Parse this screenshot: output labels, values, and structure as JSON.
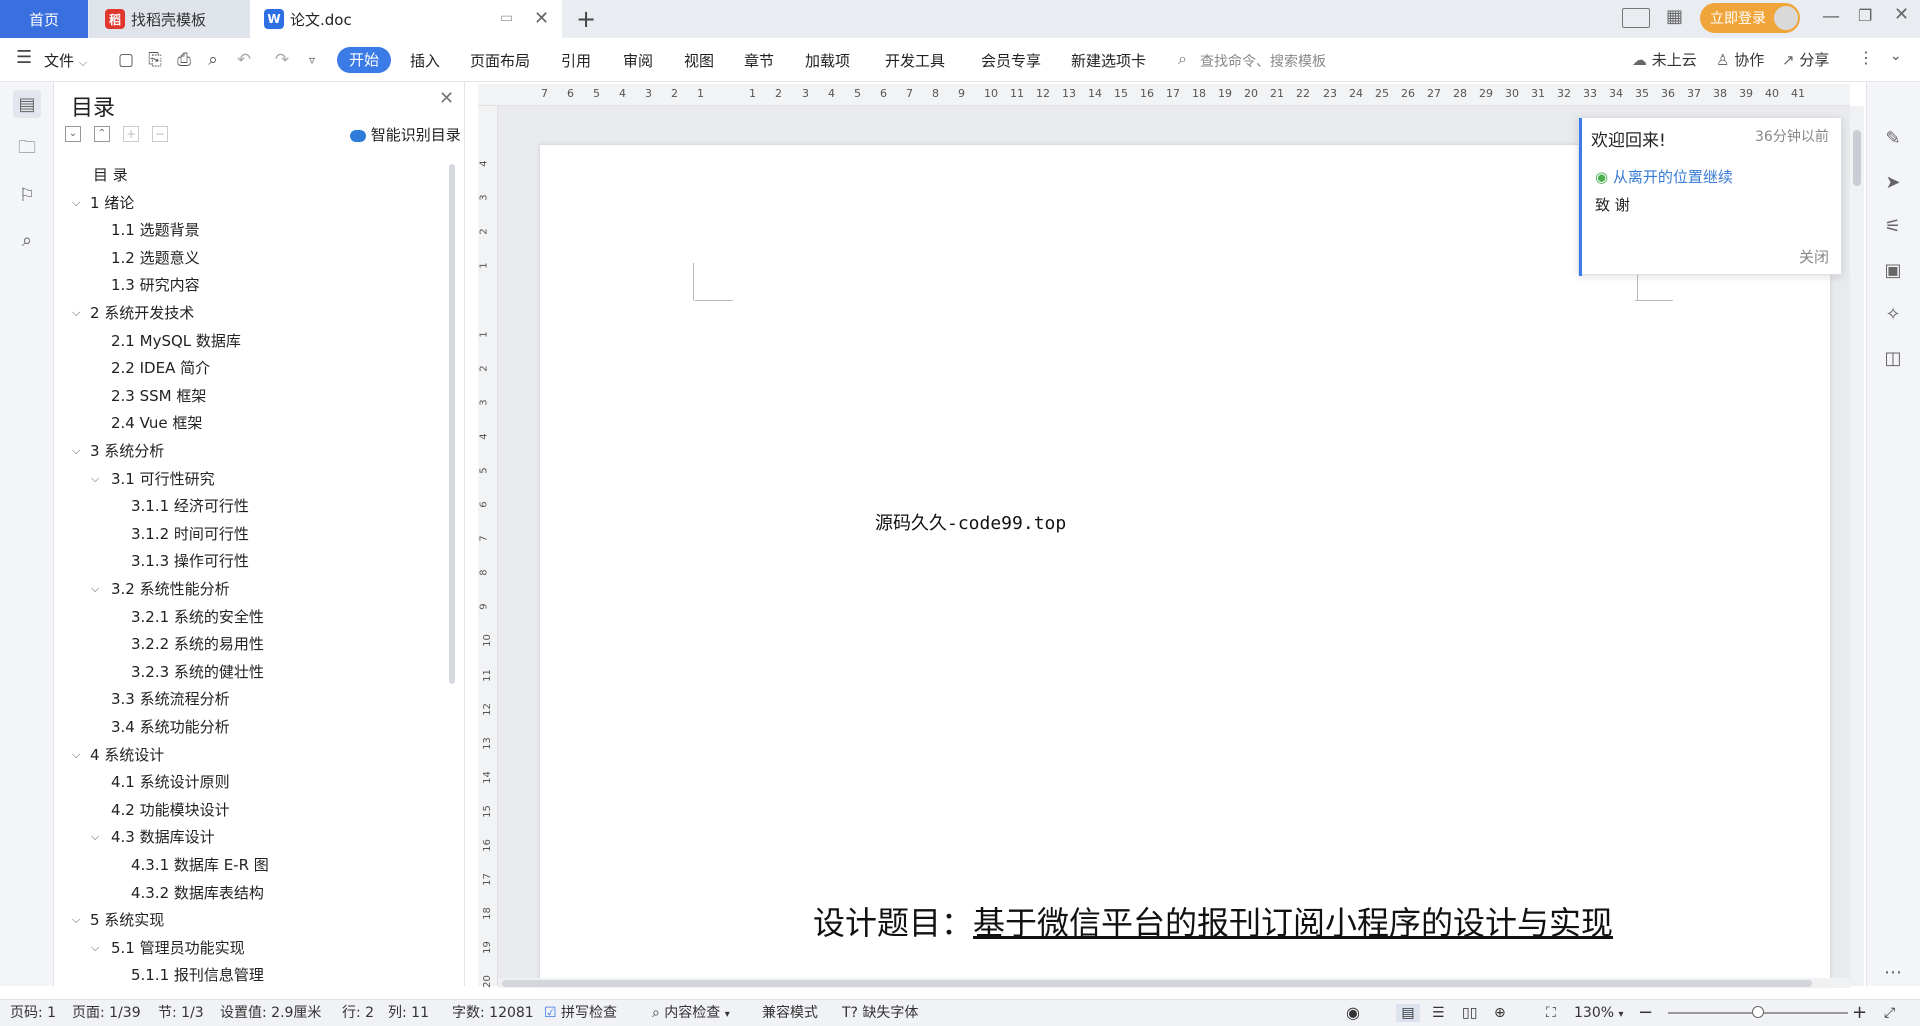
{
  "tabs": {
    "home": "首页",
    "daoke": "找稻壳模板",
    "doc": "论文.doc"
  },
  "header": {
    "login": "立即登录"
  },
  "toolbar": {
    "file": "文件",
    "menus": [
      "开始",
      "插入",
      "页面布局",
      "引用",
      "审阅",
      "视图",
      "章节",
      "加载项",
      "开发工具",
      "会员专享",
      "新建选项卡"
    ],
    "search_placeholder": "查找命令、搜索模板",
    "cloud": "未上云",
    "collab": "协作",
    "share": "分享"
  },
  "toc": {
    "title": "目录",
    "smart": "智能识别目录",
    "items": [
      {
        "text": "目  录",
        "level": 0,
        "chev": false
      },
      {
        "text": "1 绪论",
        "level": 0,
        "chev": true
      },
      {
        "text": "1.1  选题背景",
        "level": 1,
        "chev": false
      },
      {
        "text": "1.2  选题意义",
        "level": 1,
        "chev": false
      },
      {
        "text": "1.3  研究内容",
        "level": 1,
        "chev": false
      },
      {
        "text": "2  系统开发技术",
        "level": 0,
        "chev": true
      },
      {
        "text": "2.1 MySQL 数据库",
        "level": 1,
        "chev": false
      },
      {
        "text": "2.2 IDEA 简介",
        "level": 1,
        "chev": false
      },
      {
        "text": "2.3 SSM 框架",
        "level": 1,
        "chev": false
      },
      {
        "text": "2.4 Vue 框架",
        "level": 1,
        "chev": false
      },
      {
        "text": "3  系统分析",
        "level": 0,
        "chev": true
      },
      {
        "text": "3.1  可行性研究",
        "level": 1,
        "chev": true
      },
      {
        "text": "3.1.1  经济可行性",
        "level": 2,
        "chev": false
      },
      {
        "text": "3.1.2  时间可行性",
        "level": 2,
        "chev": false
      },
      {
        "text": "3.1.3  操作可行性",
        "level": 2,
        "chev": false
      },
      {
        "text": "3.2  系统性能分析",
        "level": 1,
        "chev": true
      },
      {
        "text": "3.2.1  系统的安全性",
        "level": 2,
        "chev": false
      },
      {
        "text": "3.2.2  系统的易用性",
        "level": 2,
        "chev": false
      },
      {
        "text": "3.2.3  系统的健壮性",
        "level": 2,
        "chev": false
      },
      {
        "text": "3.3  系统流程分析",
        "level": 1,
        "chev": false
      },
      {
        "text": "3.4  系统功能分析",
        "level": 1,
        "chev": false
      },
      {
        "text": "4  系统设计",
        "level": 0,
        "chev": true
      },
      {
        "text": "4.1  系统设计原则",
        "level": 1,
        "chev": false
      },
      {
        "text": "4.2  功能模块设计",
        "level": 1,
        "chev": false
      },
      {
        "text": "4.3  数据库设计",
        "level": 1,
        "chev": true
      },
      {
        "text": "4.3.1  数据库 E-R 图",
        "level": 2,
        "chev": false
      },
      {
        "text": "4.3.2  数据库表结构",
        "level": 2,
        "chev": false
      },
      {
        "text": "5  系统实现",
        "level": 0,
        "chev": true
      },
      {
        "text": "5.1  管理员功能实现",
        "level": 1,
        "chev": true
      },
      {
        "text": "5.1.1  报刊信息管理",
        "level": 2,
        "chev": false
      }
    ]
  },
  "ruler": {
    "top": [
      "7",
      "6",
      "5",
      "4",
      "3",
      "2",
      "1",
      "",
      "1",
      "2",
      "3",
      "4",
      "5",
      "6",
      "7",
      "8",
      "9",
      "10",
      "11",
      "12",
      "13",
      "14",
      "15",
      "16",
      "17",
      "18",
      "19",
      "20",
      "21",
      "22",
      "23",
      "24",
      "25",
      "26",
      "27",
      "28",
      "29",
      "30",
      "31",
      "32",
      "33",
      "34",
      "35",
      "36",
      "37",
      "38",
      "39",
      "40",
      "41"
    ],
    "left": [
      "4",
      "3",
      "2",
      "1",
      "",
      "1",
      "2",
      "3",
      "4",
      "5",
      "6",
      "7",
      "8",
      "9",
      "10",
      "11",
      "12",
      "13",
      "14",
      "15",
      "16",
      "17",
      "18",
      "19",
      "20"
    ]
  },
  "document": {
    "source_line": "源码久久-code99.top",
    "title_label": "设计题目：",
    "title_value": "基于微信平台的报刊订阅小程序的设计与实现"
  },
  "popup": {
    "title": "欢迎回来!",
    "time": "36分钟以前",
    "continue": "从离开的位置继续",
    "item": "致  谢",
    "close": "关闭"
  },
  "status": {
    "page_code": "页码: 1",
    "page": "页面: 1/39",
    "section": "节: 1/3",
    "setting": "设置值: 2.9厘米",
    "row": "行: 2",
    "col": "列: 11",
    "words": "字数: 12081",
    "spell": "拼写检查",
    "content_check": "内容检查",
    "compat": "兼容模式",
    "missing_font": "缺失字体",
    "zoom": "130%"
  },
  "colors": {
    "accent": "#3a7be8",
    "tab_home": "#3a6fe0",
    "login": "#f0a53a",
    "popup_link": "#3a7bd5",
    "eye": "#4caf50"
  }
}
